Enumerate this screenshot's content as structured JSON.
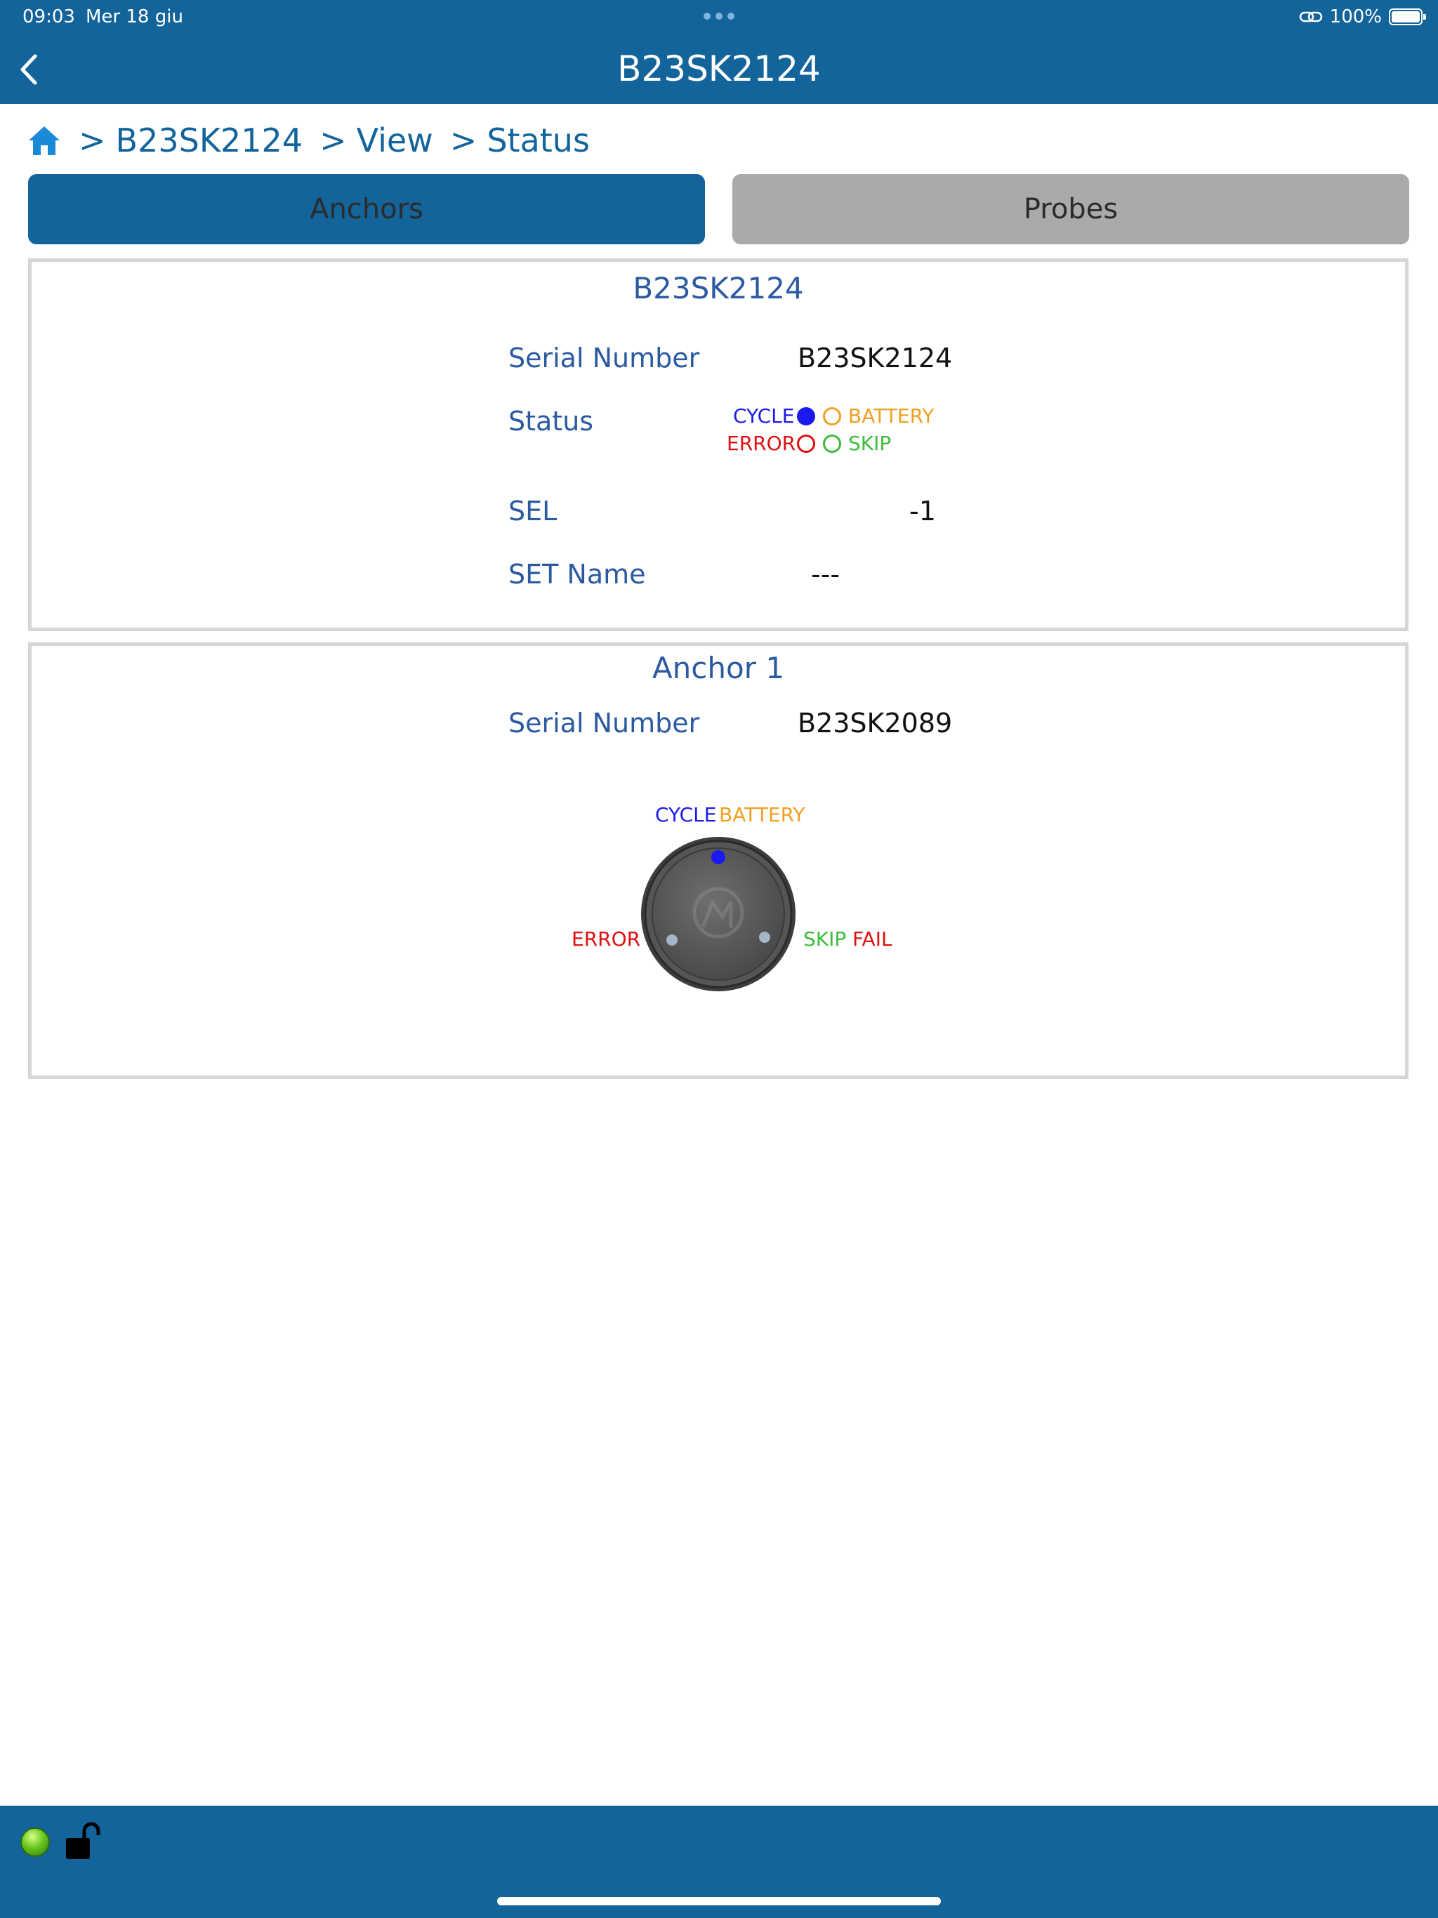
{
  "status_bar": {
    "time": "09:03",
    "date": "Mer 18 giu",
    "battery": "100%"
  },
  "nav": {
    "title": "B23SK2124"
  },
  "breadcrumb": {
    "separator": ">",
    "items": [
      "B23SK2124",
      "View",
      "Status"
    ]
  },
  "tabs": [
    {
      "label": "Anchors",
      "selected": true
    },
    {
      "label": "Probes",
      "selected": false
    }
  ],
  "device_card": {
    "title": "B23SK2124",
    "serial_label": "Serial Number",
    "serial_value": "B23SK2124",
    "status_label": "Status",
    "status": {
      "cycle": {
        "label": "CYCLE",
        "active": true
      },
      "battery": {
        "label": "BATTERY",
        "active": false
      },
      "error": {
        "label": "ERROR",
        "active": false
      },
      "skip": {
        "label": "SKIP",
        "active": false
      }
    },
    "sel_label": "SEL",
    "sel_value": "-1",
    "set_name_label": "SET Name",
    "set_name_value": "---"
  },
  "anchor_card": {
    "title": "Anchor 1",
    "serial_label": "Serial Number",
    "serial_value": "B23SK2089",
    "indicator": {
      "cycle_label": "CYCLE",
      "battery_label": "BATTERY",
      "error_label": "ERROR",
      "skip_label": "SKIP",
      "fail_label": "FAIL",
      "cycle_active": true
    }
  },
  "colors": {
    "primary": "#13649b",
    "tab_inactive": "#aaaaaa",
    "card_border": "#d6d6d6",
    "label_blue": "#2b5aa0",
    "cycle": "#1a1aee",
    "battery": "#f0a020",
    "error": "#e01010",
    "skip": "#3cbd3c"
  },
  "icons": {
    "back": "chevron-left-icon",
    "home": "home-icon",
    "link": "link-icon",
    "battery": "battery-icon",
    "connection": "status-led-icon",
    "lock": "unlock-icon"
  }
}
